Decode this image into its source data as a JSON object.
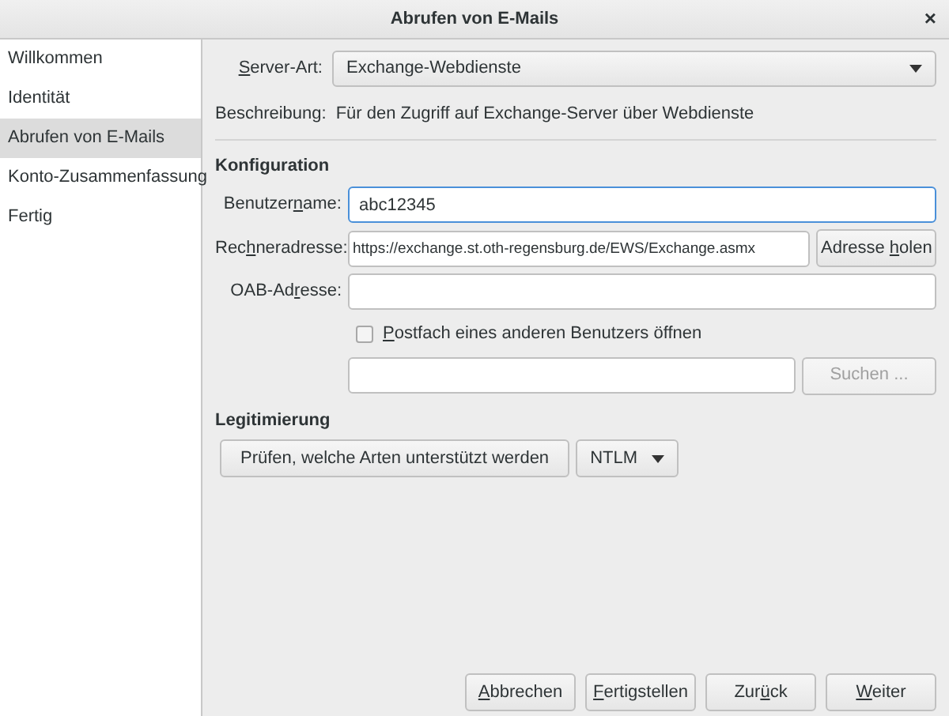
{
  "window": {
    "title": "Abrufen von E-Mails",
    "close": "×"
  },
  "sidebar": {
    "items": [
      {
        "label": "Willkommen",
        "selected": false
      },
      {
        "label": "Identität",
        "selected": false
      },
      {
        "label": "Abrufen von E-Mails",
        "selected": true
      },
      {
        "label": "Konto-Zusammenfassung",
        "selected": false
      },
      {
        "label": "Fertig",
        "selected": false
      }
    ]
  },
  "server_type": {
    "label": {
      "key": "S",
      "after": "erver-Art:"
    },
    "value": "Exchange-Webdienste"
  },
  "description": {
    "label": "Beschreibung:",
    "value": "Für den Zugriff auf Exchange-Server über Webdienste"
  },
  "configuration": {
    "heading": "Konfiguration",
    "fields": [
      {
        "label": {
          "before": "Benutzer",
          "key": "n",
          "after": "ame:"
        },
        "value": "abc12345",
        "focused": true
      },
      {
        "label": {
          "before": "Rec",
          "key": "h",
          "after": "neradresse:"
        },
        "value": "https://exchange.st.oth-regensburg.de/EWS/Exchange.asmx",
        "focused": false,
        "button": {
          "label": {
            "before": "Adresse ",
            "key": "h",
            "after": "olen"
          }
        }
      },
      {
        "label": {
          "before": "OAB-Ad",
          "key": "r",
          "after": "esse:"
        },
        "focused": false
      }
    ],
    "mailbox_checkbox": {
      "label": {
        "key": "P",
        "after": "ostfach eines anderen Benutzers öffnen"
      },
      "checked": false
    },
    "mailbox_field": {
      "focused": false,
      "button": {
        "label": {
          "after": "Suchen ..."
        },
        "disabled": true
      }
    }
  },
  "authentication": {
    "heading": "Legitimierung",
    "check_button": "Prüfen, welche Arten unterstützt werden",
    "method": "NTLM"
  },
  "buttons": [
    {
      "key": "A",
      "after": "bbrechen"
    },
    {
      "key": "F",
      "after": "ertigstellen"
    },
    {
      "before": "Zur",
      "key": "ü",
      "after": "ck"
    },
    {
      "key": "W",
      "after": "eiter"
    }
  ]
}
